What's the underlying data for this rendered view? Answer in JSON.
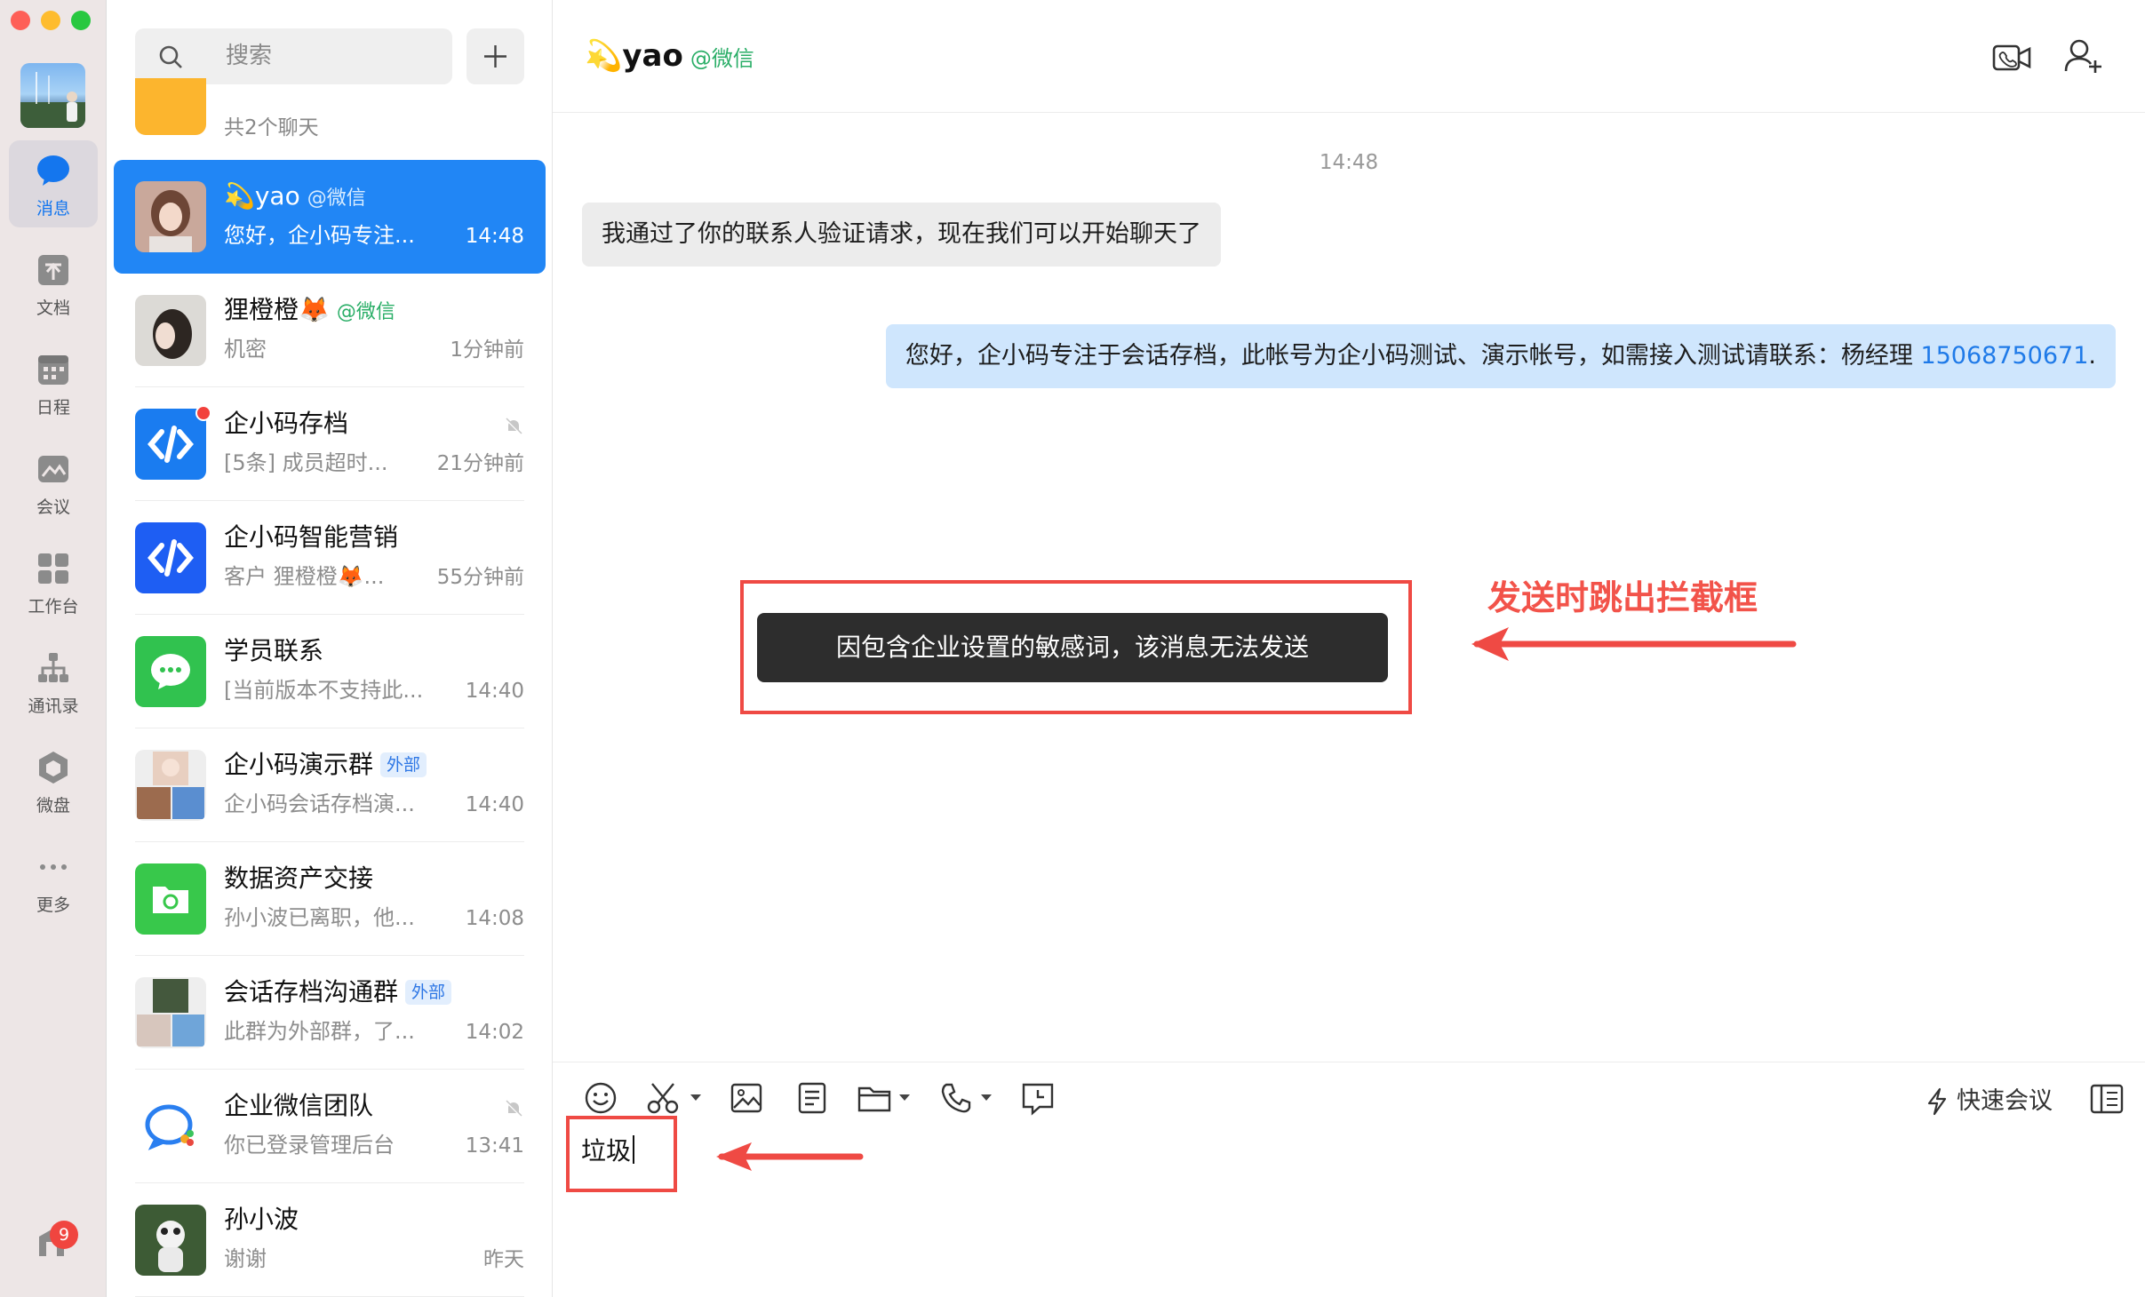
{
  "nav": {
    "items": [
      {
        "key": "messages",
        "label": "消息",
        "icon": "chat-bubble-icon",
        "active": true
      },
      {
        "key": "docs",
        "label": "文档",
        "icon": "document-icon"
      },
      {
        "key": "schedule",
        "label": "日程",
        "icon": "calendar-icon"
      },
      {
        "key": "meeting",
        "label": "会议",
        "icon": "meeting-icon"
      },
      {
        "key": "workbench",
        "label": "工作台",
        "icon": "grid-icon"
      },
      {
        "key": "contacts",
        "label": "通讯录",
        "icon": "org-chart-icon"
      },
      {
        "key": "drive",
        "label": "微盘",
        "icon": "drive-icon"
      },
      {
        "key": "more",
        "label": "更多",
        "icon": "ellipsis-icon"
      }
    ],
    "bottom_badge": "9"
  },
  "search": {
    "placeholder": "搜索"
  },
  "folded_group": {
    "subtitle": "共2个聊天"
  },
  "conversations": [
    {
      "name": "💫yao",
      "tag": "@微信",
      "preview": "您好，企小码专注...",
      "time": "14:48",
      "active": true
    },
    {
      "name": "狸橙橙🦊",
      "tag": "@微信",
      "preview": "机密",
      "time": "1分钟前"
    },
    {
      "name": "企小码存档",
      "preview": "[5条] 成员超时...",
      "time": "21分钟前",
      "muted": true,
      "unread_dot": true
    },
    {
      "name": "企小码智能营销",
      "preview": "客户 狸橙橙🦊...",
      "time": "55分钟前"
    },
    {
      "name": "学员联系",
      "preview": "[当前版本不支持此...",
      "time": "14:40"
    },
    {
      "name": "企小码演示群",
      "tag_ext": "外部",
      "preview": "企小码会话存档演...",
      "time": "14:40"
    },
    {
      "name": "数据资产交接",
      "preview": "孙小波已离职，他...",
      "time": "14:08"
    },
    {
      "name": "会话存档沟通群",
      "tag_ext": "外部",
      "preview": "此群为外部群，了...",
      "time": "14:02"
    },
    {
      "name": "企业微信团队",
      "preview": "你已登录管理后台",
      "time": "13:41",
      "muted": true
    },
    {
      "name": "孙小波",
      "preview": "谢谢",
      "time": "昨天"
    }
  ],
  "chat": {
    "title": "💫yao",
    "title_tag": "@微信",
    "time_divider": "14:48",
    "incoming": "我通过了你的联系人验证请求，现在我们可以开始聊天了",
    "outgoing_text": "您好，企小码专注于会话存档，此帐号为企小码测试、演示帐号，如需接入测试请联系：杨经理 ",
    "outgoing_phone": "15068750671",
    "outgoing_tail": ".",
    "toast": "因包含企业设置的敏感词，该消息无法发送",
    "annotation": "发送时跳出拦截框",
    "composer": {
      "quick_meeting": "快速会议",
      "input_value": "垃圾"
    }
  },
  "colors": {
    "accent": "#2186f5",
    "annotation_red": "#ef4a44",
    "toast_bg": "#2d2d2d",
    "wechat_green": "#2aae67"
  }
}
